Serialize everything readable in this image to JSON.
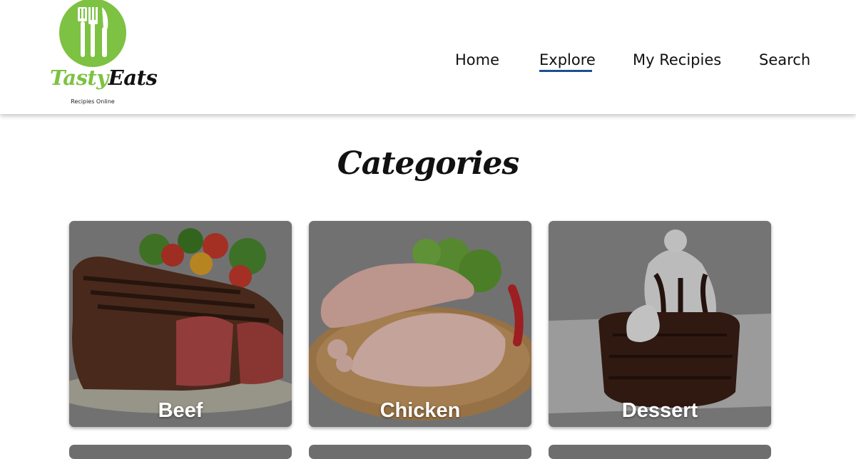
{
  "brand": {
    "name_part1": "Tasty",
    "name_part2": "Eats",
    "tagline": "Recipies Online",
    "color": "#7dc242"
  },
  "nav": {
    "items": [
      {
        "label": "Home",
        "active": false
      },
      {
        "label": "Explore",
        "active": true
      },
      {
        "label": "My Recipies",
        "active": false
      },
      {
        "label": "Search",
        "active": false
      }
    ],
    "active_color": "#1d4f91"
  },
  "main": {
    "title": "Categories",
    "categories": [
      {
        "label": "Beef",
        "image": "grilled-steak-image"
      },
      {
        "label": "Chicken",
        "image": "raw-chicken-legs-image"
      },
      {
        "label": "Dessert",
        "image": "chocolate-lava-cake-image"
      }
    ]
  }
}
